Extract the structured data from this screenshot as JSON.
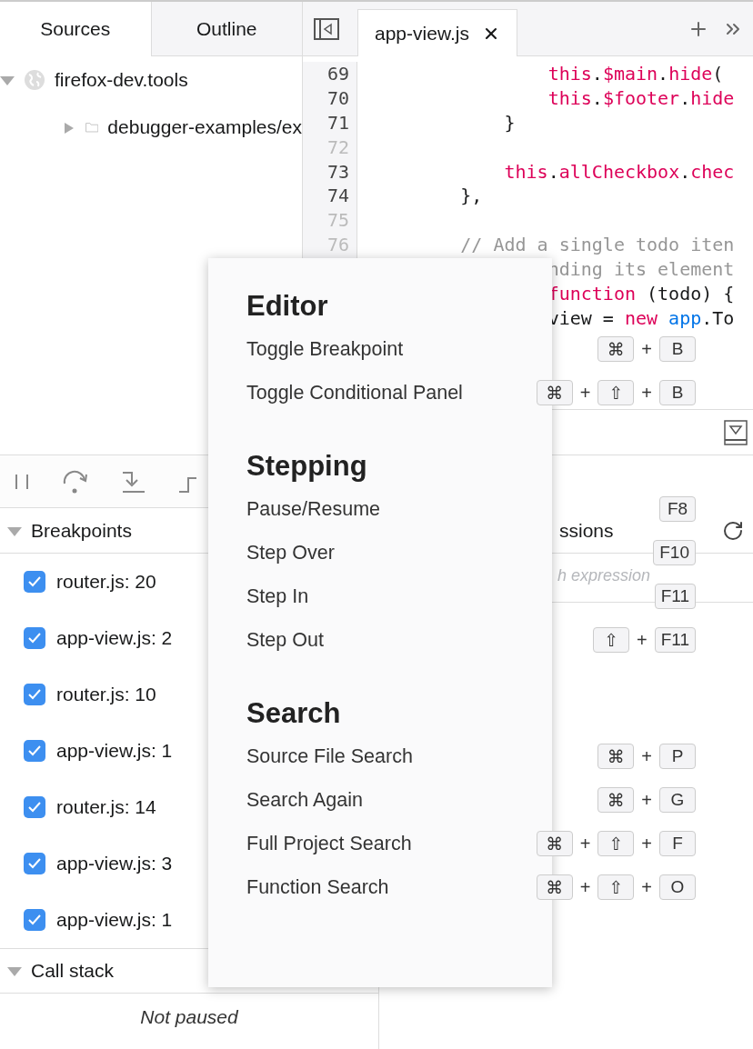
{
  "left_pane": {
    "tabs": [
      {
        "label": "Sources",
        "selected": true
      },
      {
        "label": "Outline",
        "selected": false
      }
    ],
    "tree": [
      {
        "label": "firefox-dev.tools",
        "kind": "domain",
        "expanded": true,
        "children": [
          {
            "label": "debugger-examples/ex",
            "kind": "folder",
            "expanded": false
          }
        ]
      }
    ]
  },
  "editor": {
    "tabs": [
      {
        "label": "app-view.js",
        "selected": true
      }
    ],
    "lines": [
      {
        "number": "69",
        "breakable": true,
        "tokens": [
          {
            "kind": "keyword",
            "text": "                this"
          },
          {
            "kind": "plain",
            "text": "."
          },
          {
            "kind": "keyword",
            "text": "$main"
          },
          {
            "kind": "plain",
            "text": "."
          },
          {
            "kind": "keyword",
            "text": "hide"
          },
          {
            "kind": "plain",
            "text": "("
          }
        ]
      },
      {
        "number": "70",
        "breakable": true,
        "tokens": [
          {
            "kind": "keyword",
            "text": "                this"
          },
          {
            "kind": "plain",
            "text": "."
          },
          {
            "kind": "keyword",
            "text": "$footer"
          },
          {
            "kind": "plain",
            "text": "."
          },
          {
            "kind": "keyword",
            "text": "hide"
          }
        ]
      },
      {
        "number": "71",
        "breakable": true,
        "tokens": [
          {
            "kind": "plain",
            "text": "            }"
          }
        ]
      },
      {
        "number": "72",
        "breakable": false
      },
      {
        "number": "73",
        "breakable": true,
        "tokens": [
          {
            "kind": "keyword",
            "text": "            this"
          },
          {
            "kind": "plain",
            "text": "."
          },
          {
            "kind": "keyword",
            "text": "allCheckbox"
          },
          {
            "kind": "plain",
            "text": "."
          },
          {
            "kind": "keyword",
            "text": "chec"
          }
        ]
      },
      {
        "number": "74",
        "breakable": true,
        "tokens": [
          {
            "kind": "plain",
            "text": "        },"
          }
        ]
      },
      {
        "number": "75",
        "breakable": false
      },
      {
        "number": "76",
        "breakable": false,
        "tokens": [
          {
            "kind": "comment",
            "text": "        // Add a single todo iten"
          }
        ]
      },
      {
        "tokens": [
          {
            "kind": "comment",
            "text": "                nding its element"
          }
        ]
      },
      {
        "tokens": [
          {
            "kind": "keyword",
            "text": "                function"
          },
          {
            "kind": "plain",
            "text": " (todo) {"
          }
        ]
      },
      {
        "tokens": [
          {
            "kind": "plain",
            "text": "                view = "
          },
          {
            "kind": "keyword",
            "text": "new"
          },
          {
            "kind": "builtin",
            "text": " app"
          },
          {
            "kind": "plain",
            "text": ".To"
          }
        ]
      }
    ]
  },
  "breakpoints": {
    "title": "Breakpoints",
    "expanded": true,
    "items": [
      {
        "label": "router.js: 20",
        "checked": true
      },
      {
        "label": "app-view.js: 2",
        "checked": true
      },
      {
        "label": "router.js: 10",
        "checked": true
      },
      {
        "label": "app-view.js: 1",
        "checked": true
      },
      {
        "label": "router.js: 14",
        "checked": true
      },
      {
        "label": "app-view.js: 3",
        "checked": true
      },
      {
        "label": "app-view.js: 1",
        "checked": true
      }
    ]
  },
  "call_stack": {
    "title": "Call stack",
    "expanded": true,
    "message": "Not paused"
  },
  "watch": {
    "title": "ssions",
    "placeholder": "h expression"
  },
  "shortcuts": {
    "sections": [
      {
        "title": "Editor",
        "items": [
          {
            "label": "Toggle Breakpoint",
            "keys": [
              {
                "kind": "key",
                "text": "⌘"
              },
              {
                "kind": "joiner",
                "text": "+"
              },
              {
                "kind": "key",
                "text": "B"
              }
            ]
          },
          {
            "label": "Toggle Conditional Panel",
            "keys": [
              {
                "kind": "key",
                "text": "⌘"
              },
              {
                "kind": "joiner",
                "text": "+"
              },
              {
                "kind": "key",
                "text": "⇧"
              },
              {
                "kind": "joiner",
                "text": "+"
              },
              {
                "kind": "key",
                "text": "B"
              }
            ]
          }
        ]
      },
      {
        "title": "Stepping",
        "items": [
          {
            "label": "Pause/Resume",
            "keys": [
              {
                "kind": "key",
                "text": "F8"
              }
            ]
          },
          {
            "label": "Step Over",
            "keys": [
              {
                "kind": "key",
                "text": "F10"
              }
            ]
          },
          {
            "label": "Step In",
            "keys": [
              {
                "kind": "key",
                "text": "F11"
              }
            ]
          },
          {
            "label": "Step Out",
            "keys": [
              {
                "kind": "key",
                "text": "⇧"
              },
              {
                "kind": "joiner",
                "text": "+"
              },
              {
                "kind": "key",
                "text": "F11"
              }
            ]
          }
        ]
      },
      {
        "title": "Search",
        "items": [
          {
            "label": "Source File Search",
            "keys": [
              {
                "kind": "key",
                "text": "⌘"
              },
              {
                "kind": "joiner",
                "text": "+"
              },
              {
                "kind": "key",
                "text": "P"
              }
            ]
          },
          {
            "label": "Search Again",
            "keys": [
              {
                "kind": "key",
                "text": "⌘"
              },
              {
                "kind": "joiner",
                "text": "+"
              },
              {
                "kind": "key",
                "text": "G"
              }
            ]
          },
          {
            "label": "Full Project Search",
            "keys": [
              {
                "kind": "key",
                "text": "⌘"
              },
              {
                "kind": "joiner",
                "text": "+"
              },
              {
                "kind": "key",
                "text": "⇧"
              },
              {
                "kind": "joiner",
                "text": "+"
              },
              {
                "kind": "key",
                "text": "F"
              }
            ]
          },
          {
            "label": "Function Search",
            "keys": [
              {
                "kind": "key",
                "text": "⌘"
              },
              {
                "kind": "joiner",
                "text": "+"
              },
              {
                "kind": "key",
                "text": "⇧"
              },
              {
                "kind": "joiner",
                "text": "+"
              },
              {
                "kind": "key",
                "text": "O"
              }
            ]
          }
        ]
      }
    ]
  }
}
